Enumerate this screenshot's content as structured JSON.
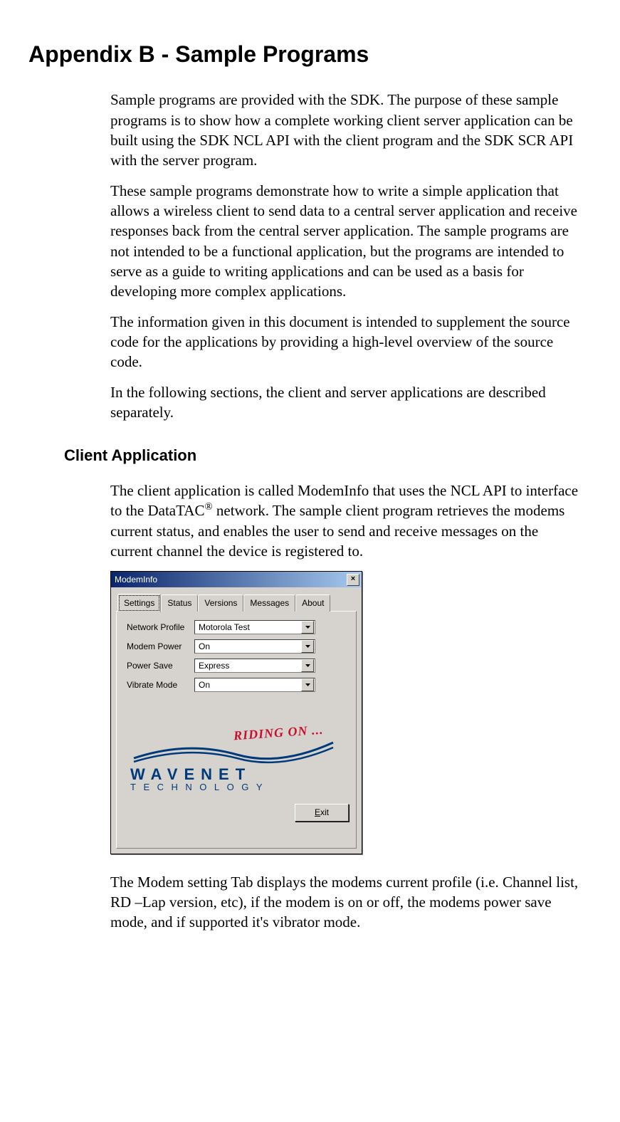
{
  "heading": "Appendix B - Sample Programs",
  "para1": "Sample programs are provided with the SDK. The purpose of these sample programs is to show how a complete working client server application can be built using the SDK NCL API with the client program and the SDK SCR API with the server program.",
  "para2": "These sample programs demonstrate how to write a simple application that allows a wireless client to send data to a central server application and receive responses back from the central server application. The sample programs are not intended to be a functional application, but the programs are intended to serve as a guide to writing applications and can be used as a basis for developing more complex applications.",
  "para3": "The information given in this document is intended to supplement the source code for the applications by providing a high-level overview of the source code.",
  "para4": "In the following sections, the client and server applications are described separately.",
  "sub_heading": "Client Application",
  "para5a": "The client application is called ModemInfo that uses the NCL API to interface to the DataTAC",
  "para5b": " network. The sample client program retrieves the modems current status, and enables the user to send and receive messages on the current channel the device is registered to.",
  "reg_mark": "®",
  "dialog": {
    "title": "ModemInfo",
    "close": "×",
    "tabs": {
      "t0": "Settings",
      "t1": "Status",
      "t2": "Versions",
      "t3": "Messages",
      "t4": "About"
    },
    "labels": {
      "network_profile": "Network Profile",
      "modem_power": "Modem Power",
      "power_save": "Power Save",
      "vibrate_mode": "Vibrate Mode"
    },
    "values": {
      "network_profile": "Motorola Test",
      "modem_power": "On",
      "power_save": "Express",
      "vibrate_mode": "On"
    },
    "logo": {
      "riding": "RIDING ON ...",
      "wavenet": "WAVENET",
      "technology": "TECHNOLOGY"
    },
    "exit_u": "E",
    "exit_rest": "xit"
  },
  "para6": "The Modem setting Tab displays the modems current profile (i.e. Channel list, RD –Lap version, etc), if the modem is on or off, the modems power save mode, and if supported it's vibrator mode."
}
